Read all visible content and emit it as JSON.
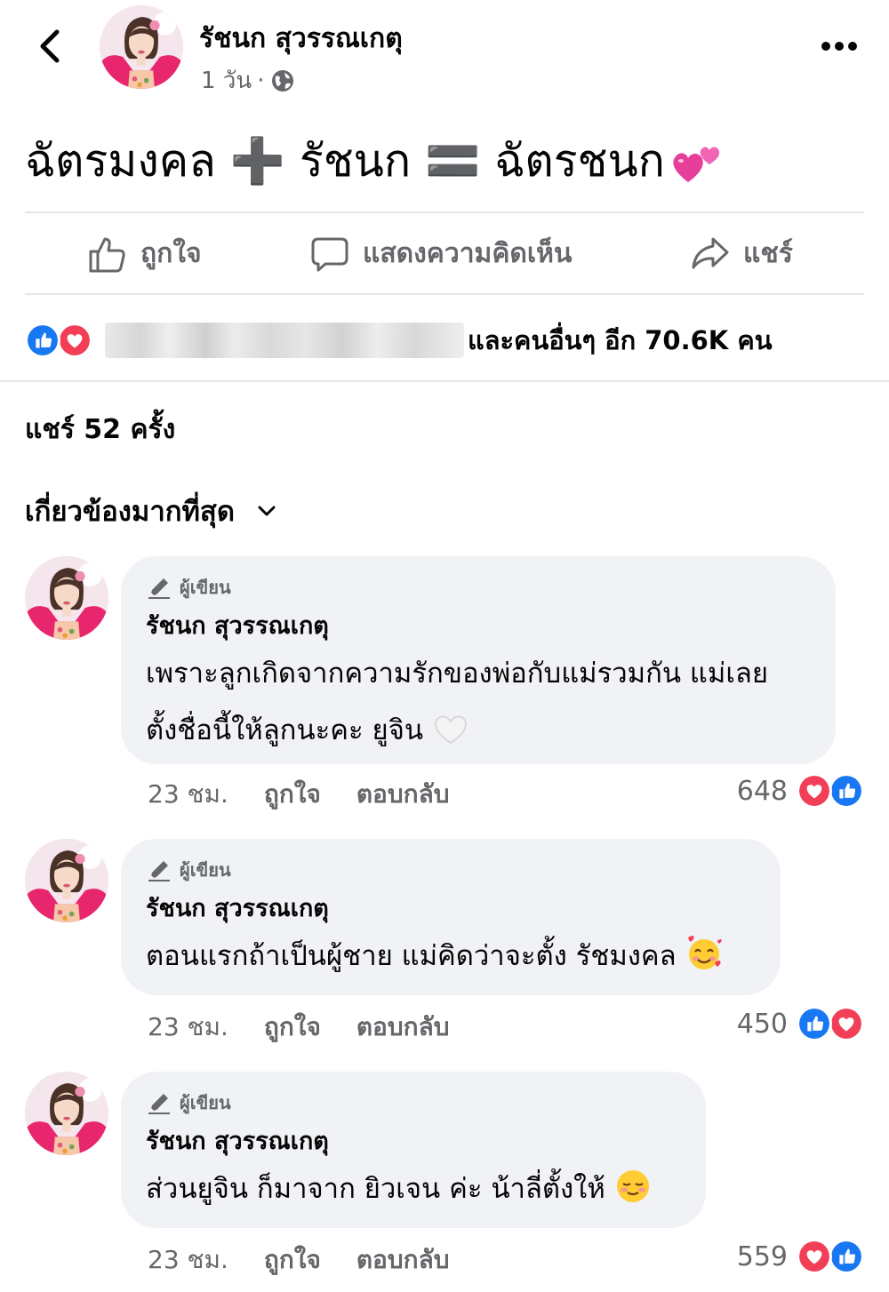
{
  "header": {
    "author_name": "รัชนก สุวรรณเกตุ",
    "time": "1 วัน",
    "separator": "·"
  },
  "post": {
    "text": "ฉัตรมงคล ➕ รัชนก 🟰 ฉัตรชนก"
  },
  "actions": {
    "like_label": "ถูกใจ",
    "comment_label": "แสดงความคิดเห็น",
    "share_label": "แชร์"
  },
  "reactions": {
    "others_text": "และคนอื่นๆ อีก 70.6K คน"
  },
  "shares_text": "แชร์ 52 ครั้ง",
  "sort_label": "เกี่ยวข้องมากที่สุด",
  "comments": [
    {
      "badge": "ผู้เขียน",
      "name": "รัชนก สุวรรณเกตุ",
      "line1": "เพราะลูกเกิดจากความรักของพ่อกับแม่รวมกัน แม่เลย",
      "line2": "ตั้งชื่อนี้ให้ลูกนะคะ ยูจิน",
      "time": "23 ชม.",
      "like_label": "ถูกใจ",
      "reply_label": "ตอบกลับ",
      "count": "648"
    },
    {
      "badge": "ผู้เขียน",
      "name": "รัชนก สุวรรณเกตุ",
      "line1": "ตอนแรกถ้าเป็นผู้ชาย แม่คิดว่าจะตั้ง รัชมงคล",
      "time": "23 ชม.",
      "like_label": "ถูกใจ",
      "reply_label": "ตอบกลับ",
      "count": "450"
    },
    {
      "badge": "ผู้เขียน",
      "name": "รัชนก สุวรรณเกตุ",
      "line1": "ส่วนยูจิน ก็มาจาก ยิวเจน ค่ะ น้าลี่ตั้งให้",
      "time": "23 ชม.",
      "like_label": "ถูกใจ",
      "reply_label": "ตอบกลับ",
      "count": "559"
    }
  ],
  "colors": {
    "like_blue": "#1877f2",
    "love_red": "#f33e58",
    "secondary_text": "#65676b",
    "bubble_bg": "#f0f2f5"
  },
  "icons": [
    "back-arrow-icon",
    "more-icon",
    "globe-icon",
    "like-icon",
    "comment-icon",
    "share-icon",
    "chevron-down-icon",
    "pen-icon",
    "love-reaction-icon",
    "like-reaction-icon",
    "two-hearts-emoji",
    "white-heart-emoji",
    "smiling-face-with-hearts-emoji",
    "smiling-face-emoji"
  ]
}
